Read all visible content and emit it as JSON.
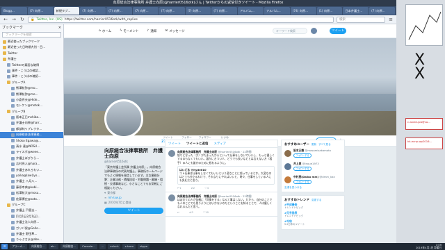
{
  "window": {
    "title": "向原総合法律事務所 弁護士向原(@harrier0516otk)さん | Twitterからの返信付きツイート - Mozilla Firefox"
  },
  "tabs": [
    {
      "label": "Blogg..."
    },
    {
      "label": "(7) 向原..."
    },
    {
      "label": "新規タブ..."
    },
    {
      "label": "(7) 向原..."
    },
    {
      "label": "(7) 向原..."
    },
    {
      "label": "(7) 向原..."
    },
    {
      "label": "(7) 向原..."
    },
    {
      "label": "(7) 向原..."
    },
    {
      "label": "(7) 向原..."
    },
    {
      "label": "アルバム..."
    },
    {
      "label": "アルバム..."
    },
    {
      "label": "(74) 向原..."
    },
    {
      "label": "(1) 向原..."
    },
    {
      "label": "日本弁護士..."
    },
    {
      "label": "(7) 向原..."
    }
  ],
  "navbar": {
    "back": "←",
    "forward": "→",
    "reload": "↻",
    "site_label": "Twitter, Inc. (US)",
    "url": "https://twitter.com/harrier0516otk/with_replies",
    "search_placeholder": "検索"
  },
  "sidebar": {
    "title": "ブックマーク",
    "close": "×",
    "search_placeholder": "ブックマークを検索",
    "items": [
      {
        "label": "最近使ったブックマーク",
        "depth": 0,
        "kind": "folder"
      },
      {
        "label": "最近使った日時順大別・目...",
        "depth": 0,
        "kind": "folder"
      },
      {
        "label": "Twitter",
        "depth": 0,
        "kind": "folder"
      },
      {
        "label": "弁護士",
        "depth": 0,
        "kind": "folder"
      },
      {
        "label": "Twitterの素面な確得",
        "depth": 1,
        "kind": "link"
      },
      {
        "label": "事件・こうばの確認...",
        "depth": 1,
        "kind": "link"
      },
      {
        "label": "事件・こうばの確認...",
        "depth": 1,
        "kind": "link"
      },
      {
        "label": "グループA",
        "depth": 1,
        "kind": "folder"
      },
      {
        "label": "熊澤航弥@mo...",
        "depth": 2,
        "kind": "link"
      },
      {
        "label": "熊澤航弥@mo...",
        "depth": 2,
        "kind": "link"
      },
      {
        "label": "小倉秀夫@Hide...",
        "depth": 2,
        "kind": "link"
      },
      {
        "label": "モトケン@motok...",
        "depth": 2,
        "kind": "link"
      },
      {
        "label": "グループB",
        "depth": 1,
        "kind": "folder"
      },
      {
        "label": "阪本正巳mshiba...",
        "depth": 2,
        "kind": "link"
      },
      {
        "label": "弁護士向原@harr...",
        "depth": 2,
        "kind": "link"
      },
      {
        "label": "都部純リプレクタ...",
        "depth": 2,
        "kind": "link"
      },
      {
        "label": "向原総合法律事務...",
        "depth": 2,
        "kind": "link",
        "selected": true
      },
      {
        "label": "Shoko Egawa@...",
        "depth": 2,
        "kind": "link"
      },
      {
        "label": "清水 達@NOSU...",
        "depth": 2,
        "kind": "link"
      },
      {
        "label": "ライスボ@weee...",
        "depth": 2,
        "kind": "link"
      },
      {
        "label": "弁護士ぼびりら...",
        "depth": 2,
        "kind": "link"
      },
      {
        "label": "吉村亮人@hara...",
        "depth": 2,
        "kind": "link"
      },
      {
        "label": "弁護士あれろもい...",
        "depth": 2,
        "kind": "link"
      },
      {
        "label": "yoika@law(lyo...",
        "depth": 2,
        "kind": "link"
      },
      {
        "label": "弁護士 八月八...",
        "depth": 2,
        "kind": "link"
      },
      {
        "label": "藤原幸典@kobi...",
        "depth": 2,
        "kind": "link"
      },
      {
        "label": "松澤航大@mosu...",
        "depth": 2,
        "kind": "link"
      },
      {
        "label": "佐藤博史@sato...",
        "depth": 2,
        "kind": "link"
      },
      {
        "label": "グループC",
        "depth": 1,
        "kind": "folder"
      },
      {
        "label": "弁護士 戸舘圭...",
        "depth": 2,
        "kind": "link"
      },
      {
        "label": "[1月1日2月1日]...",
        "depth": 2,
        "kind": "link"
      },
      {
        "label": "弁護士法人向原...",
        "depth": 2,
        "kind": "link"
      },
      {
        "label": "ガリバ保@Gollo...",
        "depth": 2,
        "kind": "link"
      },
      {
        "label": "弁護士 野田隼...",
        "depth": 2,
        "kind": "link"
      },
      {
        "label": "りゃぶさま@abe...",
        "depth": 2,
        "kind": "link"
      },
      {
        "label": "弁護士 三浦(...",
        "depth": 2,
        "kind": "link"
      }
    ]
  },
  "twitter": {
    "nav": {
      "home": "ホーム",
      "moments": "モーメント",
      "notifications": "通知",
      "messages": "メッセージ"
    },
    "search_placeholder": "キーワード検索",
    "tweet_button": "ツイート",
    "stats": [
      {
        "label": "ツイート",
        "value": "27,431"
      },
      {
        "label": "フォロー",
        "value": "216"
      },
      {
        "label": "フォロワー",
        "value": "2,640"
      },
      {
        "label": "いいね",
        "value": "28,998"
      }
    ],
    "follow_button": "フォロー中",
    "more": "⋮",
    "profile": {
      "name": "向原総合法律事務所　弁護士向原",
      "handle": "@harrier0516otk",
      "bio": "「東京弁護士会所属 弁護士向原」。向原総合法律事務所の代表弁護士。事務所ホームページでもよく情報を発信しています。主な業務分野：企業法務・債権回収・労働問題・離婚・相続・交通事故など。小さなことでもお気軽にご相談ください。",
      "location": "東京都",
      "link": "mh-law.jp",
      "joined": "2010年7月に登録",
      "tweet_button": "ツイート"
    },
    "timeline": {
      "tabs": [
        "ツイート",
        "ツイートと返信",
        "メディア"
      ],
      "tweets": [
        {
          "author": "向原総合法律事務所　弁護士向原",
          "meta": "@harrier0516otk · 22時間",
          "text": "怒りになった（大）がたまったからといって仕事をしないでいいし、もっと優しくするのもなくてもいい。誰かにきつい人、どうでも良いなどとは言えない方（相手）の人にも誰かのために怒れるように。",
          "reply": "はいどる @hyde010",
          "reply_text": "コト仕事は仕事をしなくてもいいという変なことに怒っているとか。大変なのはとても分かるわけで、それなりにやればいいと、時々、仕事をしている人にも失礼だと思う。",
          "replies": "1",
          "retweets": "2",
          "likes": "4"
        },
        {
          "author": "向原総合法律事務所　弁護士向原",
          "meta": "@harrier0516otk · 22時間",
          "text": "ほぼ全ての人が気軽に「同情をする」なんて事はしない。だから、自分のことでも人のことでも思うようにはいかないのだということを知ることで、人は優しくなれるんだと思う。",
          "replies": "",
          "retweets": "3",
          "likes": "10"
        }
      ]
    },
    "who_to_follow": {
      "title": "おすすめユーザー",
      "refresh": "更新",
      "view_all": "すべて見る",
      "users": [
        {
          "name": "阪本正樹",
          "handle": "@masamisakamoto",
          "follow": "フォローする",
          "color": "#8a6d4c"
        },
        {
          "name": "井上恵",
          "handle": "@inoue1973",
          "follow": "フォローする",
          "color": "#5d7896"
        },
        {
          "name": "中村朋(Daiko mm)",
          "handle": "@dmm_kan",
          "follow": "フォローする",
          "color": "#c47b3c"
        }
      ],
      "find_friends": "友達を見つける"
    },
    "trends": {
      "title": "おすすめトレンド",
      "change": "変更する",
      "items": [
        {
          "name": "#平成最後",
          "sub": "トレンドトピック"
        },
        {
          "name": "#元号発表",
          "sub": "トレンドトピック"
        },
        {
          "name": "#令和",
          "sub": "5.2万件のツイート"
        }
      ]
    }
  },
  "desktop": {
    "notif1": "c-loved-job@co...",
    "notif2": "kk-ecnp-wp2016..."
  },
  "taskbar": {
    "items": [
      "アラーム...",
      "向原総合...",
      "ab...",
      "向原総合...",
      "Console...",
      "...",
      "eclcch",
      "x-term",
      "skype"
    ],
    "time": "7:59",
    "date": "2019年4月1日月曜日"
  },
  "colors": {
    "twitter_blue": "#1da1f2",
    "selection": "#3b83d8",
    "titlebar": "#2f3b4c"
  }
}
